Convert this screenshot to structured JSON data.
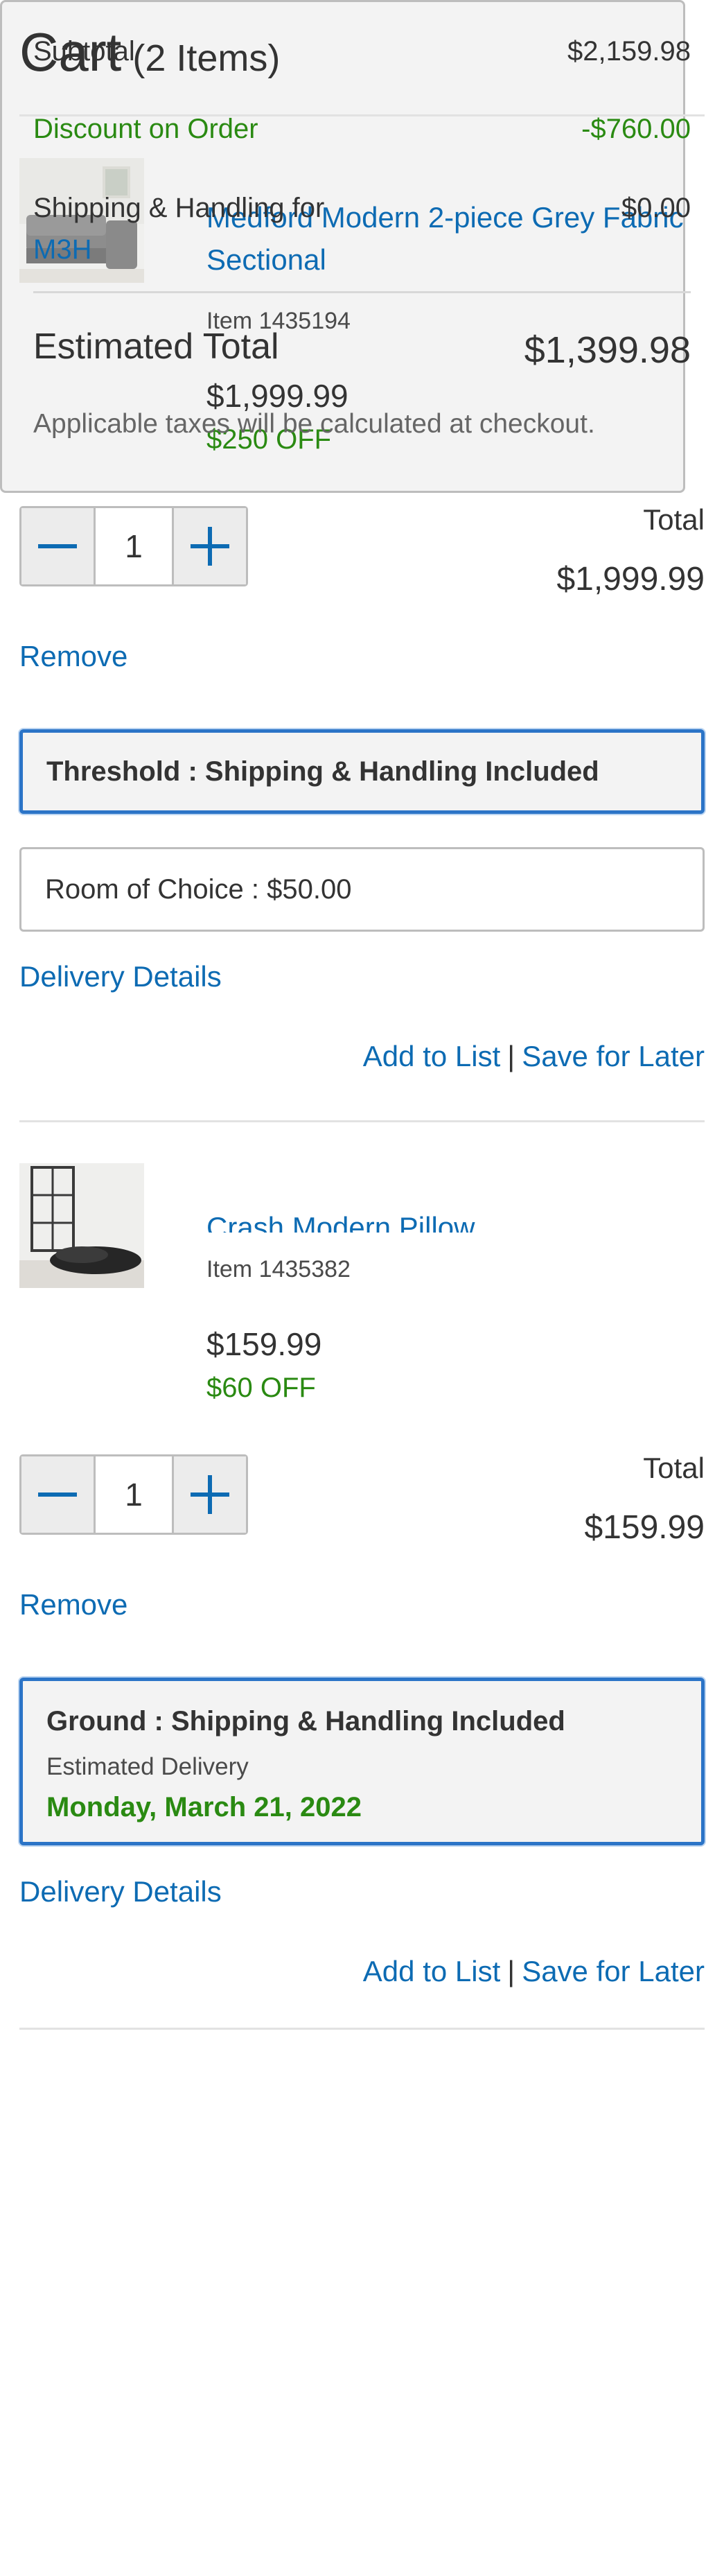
{
  "header": {
    "title": "Cart",
    "item_count": "(2 Items)"
  },
  "items": [
    {
      "name": "Medford Modern 2-piece Grey Fabric Sectional",
      "item_number": "Item 1435194",
      "price": "$1,999.99",
      "discount": "$250 OFF",
      "quantity": "1",
      "total_label": "Total",
      "total": "$1,999.99",
      "remove_label": "Remove",
      "shipping_selected": "Threshold : Shipping & Handling Included",
      "shipping_option": "Room of Choice : $50.00",
      "delivery_details_label": "Delivery Details",
      "add_to_list_label": "Add to List",
      "separator": "|",
      "save_for_later_label": "Save for Later"
    },
    {
      "name": "Crash Modern Pillow",
      "item_number": "Item 1435382",
      "price": "$159.99",
      "discount": "$60 OFF",
      "quantity": "1",
      "total_label": "Total",
      "total": "$159.99",
      "remove_label": "Remove",
      "shipping_selected": "Ground : Shipping & Handling Included",
      "estimated_delivery_label": "Estimated Delivery",
      "estimated_delivery_date": "Monday, March 21, 2022",
      "delivery_details_label": "Delivery Details",
      "add_to_list_label": "Add to List",
      "separator": "|",
      "save_for_later_label": "Save for Later"
    }
  ],
  "summary": {
    "subtotal_label": "Subtotal",
    "subtotal": "$2,159.98",
    "discount_label": "Discount on Order",
    "discount": "-$760.00",
    "shipping_label": "Shipping & Handling for",
    "shipping_postal": "M3H",
    "shipping": "$0.00",
    "estimated_total_label": "Estimated Total",
    "estimated_total": "$1,399.98",
    "tax_note": "Applicable taxes will be calculated at checkout."
  },
  "colors": {
    "link": "#0d6bb3",
    "discount": "#2a8a12",
    "selected_border": "#2b74c7"
  },
  "icons": [
    "minus-icon",
    "plus-icon"
  ]
}
